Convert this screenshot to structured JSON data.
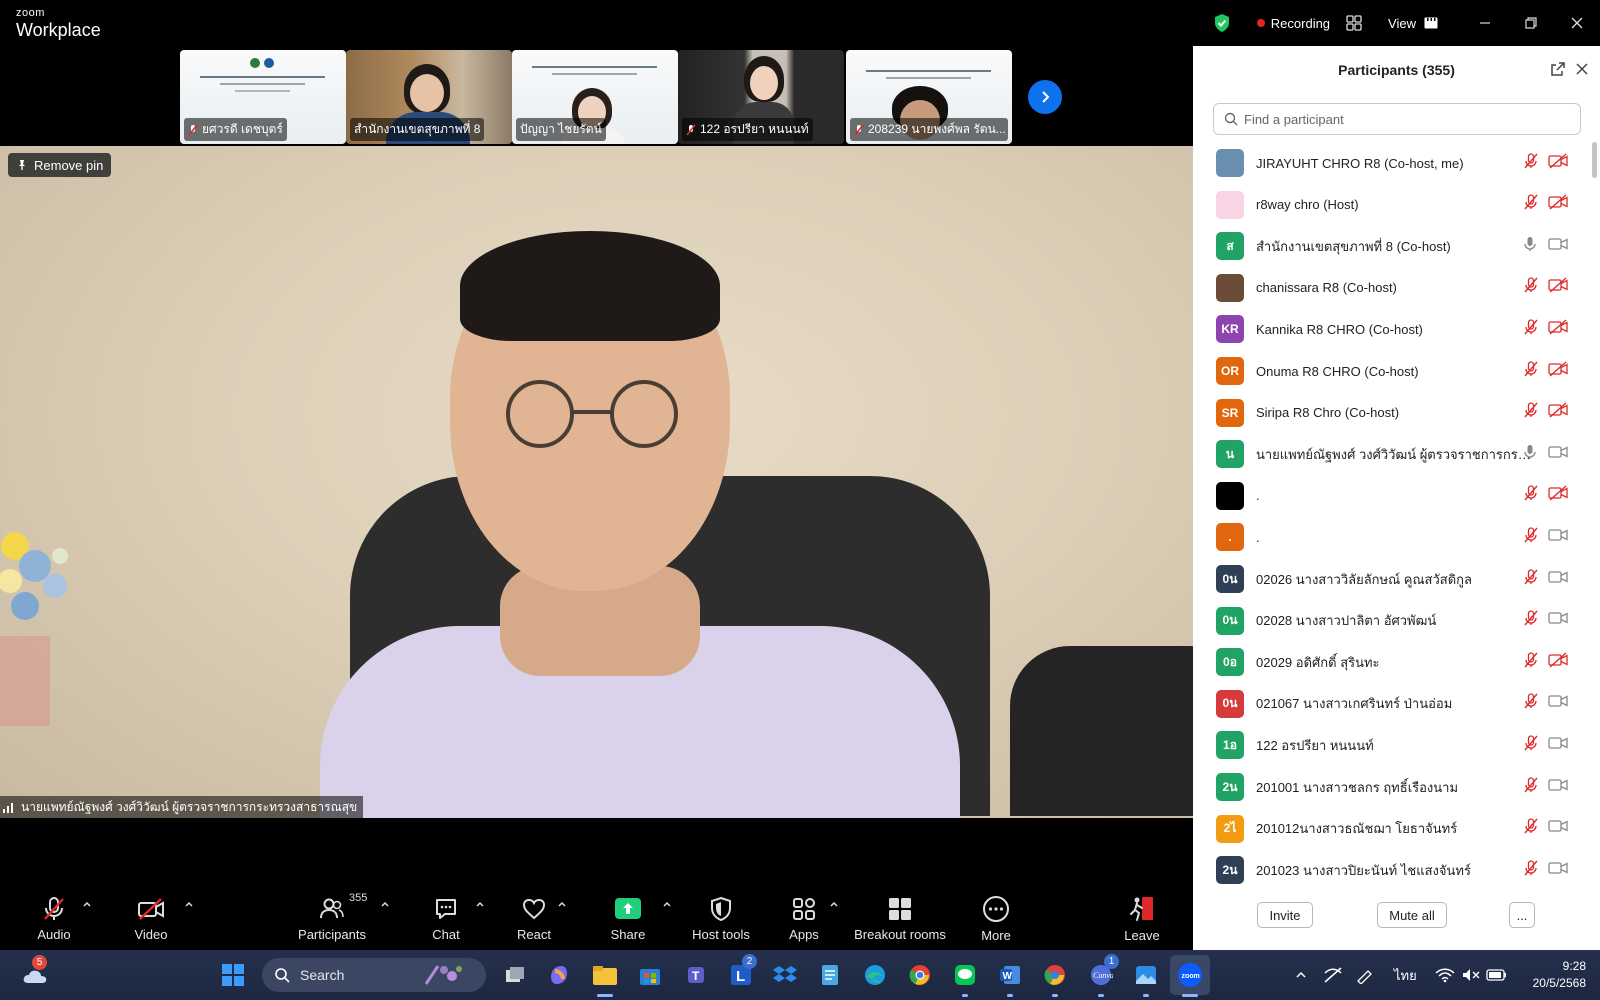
{
  "app": {
    "logo_small": "zoom",
    "logo_big": "Workplace"
  },
  "titlebar": {
    "recording_label": "Recording",
    "view_label": "View"
  },
  "strip": {
    "tiles": [
      {
        "name": "ยศวรดี เดชบุตร์"
      },
      {
        "name": "สำนักงานเขตสุขภาพที่ 8"
      },
      {
        "name": "ปัญญา ไชยรัตน์"
      },
      {
        "name": "122 อรปรียา หนนนท์"
      },
      {
        "name": "208239 นายพงศ์พล รัตน..."
      }
    ]
  },
  "main": {
    "remove_pin_label": "Remove pin",
    "speaker_name": "นายแพทย์ณัฐพงศ์ วงศ์วิวัฒน์ ผู้ตรวจราชการกระทรวงสาธารณสุข"
  },
  "toolbar": {
    "audio": "Audio",
    "video": "Video",
    "participants": "Participants",
    "participants_count": "355",
    "chat": "Chat",
    "react": "React",
    "share": "Share",
    "host_tools": "Host tools",
    "apps": "Apps",
    "breakout_rooms": "Breakout rooms",
    "more": "More",
    "leave": "Leave"
  },
  "panel": {
    "title": "Participants (355)",
    "search_placeholder": "Find a participant",
    "invite_label": "Invite",
    "mute_all_label": "Mute all",
    "more_label": "...",
    "participants": [
      {
        "name": "JIRAYUHT CHRO R8 (Co-host, me)",
        "avatar_text": "",
        "avatar_color": "#6b8fb0",
        "mic": "muted",
        "cam": "off"
      },
      {
        "name": "r8way chro (Host)",
        "avatar_text": "",
        "avatar_color": "#f8d4e4",
        "mic": "muted",
        "cam": "off"
      },
      {
        "name": "สำนักงานเขตสุขภาพที่ 8 (Co-host)",
        "avatar_text": "ส",
        "avatar_color": "#21a366",
        "mic": "on",
        "cam": "on"
      },
      {
        "name": "chanissara R8 (Co-host)",
        "avatar_text": "",
        "avatar_color": "#6b4a36",
        "mic": "muted",
        "cam": "off"
      },
      {
        "name": "Kannika R8 CHRO (Co-host)",
        "avatar_text": "KR",
        "avatar_color": "#8e44ad",
        "mic": "muted",
        "cam": "off"
      },
      {
        "name": "Onuma R8 CHRO (Co-host)",
        "avatar_text": "OR",
        "avatar_color": "#e0670d",
        "mic": "muted",
        "cam": "off"
      },
      {
        "name": "Siripa R8 Chro (Co-host)",
        "avatar_text": "SR",
        "avatar_color": "#e0670d",
        "mic": "muted",
        "cam": "off"
      },
      {
        "name": "นายแพทย์ณัฐพงศ์ วงศ์วิวัฒน์ ผู้ตรวจราชการกระทรวง...",
        "avatar_text": "น",
        "avatar_color": "#21a366",
        "mic": "on",
        "cam": "on"
      },
      {
        "name": ".",
        "avatar_text": "",
        "avatar_color": "#000000",
        "mic": "muted",
        "cam": "off"
      },
      {
        "name": ".",
        "avatar_text": ".",
        "avatar_color": "#e0670d",
        "mic": "muted",
        "cam": "on"
      },
      {
        "name": "02026 นางสาววิลัยลักษณ์ คูณสวัสดิกูล",
        "avatar_text": "0น",
        "avatar_color": "#2f3f55",
        "mic": "muted",
        "cam": "on"
      },
      {
        "name": "02028 นางสาวปาลิตา อัศวพัฒน์",
        "avatar_text": "0น",
        "avatar_color": "#21a366",
        "mic": "muted",
        "cam": "on"
      },
      {
        "name": "02029 อดิศักดิ์ สุรินทะ",
        "avatar_text": "0อ",
        "avatar_color": "#21a366",
        "mic": "muted",
        "cam": "off"
      },
      {
        "name": "021067 นางสาวเกศรินทร์ ป่านอ่อม",
        "avatar_text": "0น",
        "avatar_color": "#d63a3a",
        "mic": "muted",
        "cam": "on"
      },
      {
        "name": "122 อรปรียา หนนนท์",
        "avatar_text": "1อ",
        "avatar_color": "#21a366",
        "mic": "muted",
        "cam": "on"
      },
      {
        "name": "201001 นางสาวชลกร ฤทธิ์เรืองนาม",
        "avatar_text": "2น",
        "avatar_color": "#21a366",
        "mic": "muted",
        "cam": "on"
      },
      {
        "name": "201012นางสาวธณัชฌา โยธาจันทร์",
        "avatar_text": "2ไ",
        "avatar_color": "#f39c12",
        "mic": "muted",
        "cam": "on"
      },
      {
        "name": "201023 นางสาวปิยะนันท์ ไชแสงจันทร์",
        "avatar_text": "2น",
        "avatar_color": "#2f3f55",
        "mic": "muted",
        "cam": "on"
      }
    ]
  },
  "taskbar": {
    "weather_badge": "5",
    "search_label": "Search",
    "l_badge": "2",
    "canva_badge": "1",
    "lang": "ไทย",
    "time": "9:28",
    "date": "20/5/2568"
  },
  "colors": {
    "accent": "#0e72ed",
    "muted_red": "#e02828",
    "share_green": "#1fd07b",
    "recording_dot": "#e02828"
  }
}
